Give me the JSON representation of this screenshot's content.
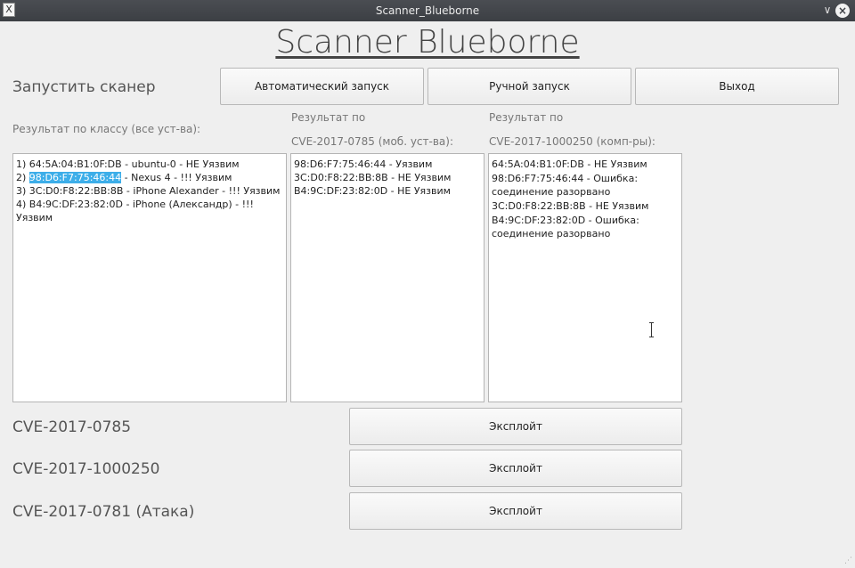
{
  "window": {
    "title": "Scanner_Blueborne",
    "app_icon_glyph": "X",
    "minimize_glyph": "∨",
    "close_glyph": "×"
  },
  "app_title": "Scanner Blueborne",
  "scanner": {
    "label": "Запустить сканер",
    "auto_button": "Автоматический запуск",
    "manual_button": "Ручной запуск",
    "exit_button": "Выход"
  },
  "results": {
    "class_header": "Результат по классу (все уст-ва):",
    "mob_header_1": "Результат по",
    "mob_header_2": "CVE-2017-0785 (моб. уст-ва):",
    "comp_header_1": "Результат по",
    "comp_header_2": "CVE-2017-1000250 (комп-ры):",
    "class_items": [
      {
        "num": "1)",
        "mac": "64:5A:04:B1:0F:DB",
        "rest": " - ubuntu-0 - НЕ Уязвим"
      },
      {
        "num": "2)",
        "mac": "98:D6:F7:75:46:44",
        "rest": " - Nexus 4 - !!!  Уязвим"
      },
      {
        "num": "3)",
        "mac": "3C:D0:F8:22:BB:8B",
        "rest": " - iPhone Alexander - !!!  Уязвим"
      },
      {
        "num": "4)",
        "mac": "B4:9C:DF:23:82:0D",
        "rest": " - iPhone (Александр) - !!!  Уязвим"
      }
    ],
    "mob_items": [
      "98:D6:F7:75:46:44 - Уязвим",
      "3C:D0:F8:22:BB:8B - НЕ Уязвим",
      "B4:9C:DF:23:82:0D - НЕ Уязвим"
    ],
    "comp_items": [
      "64:5A:04:B1:0F:DB - НЕ Уязвим",
      "98:D6:F7:75:46:44 - Ошибка: соединение разорвано",
      "3C:D0:F8:22:BB:8B - НЕ Уязвим",
      "B4:9C:DF:23:82:0D - Ошибка: соединение разорвано"
    ]
  },
  "exploits": [
    {
      "label": "CVE-2017-0785",
      "button": "Эксплойт"
    },
    {
      "label": "CVE-2017-1000250",
      "button": "Эксплойт"
    },
    {
      "label": "CVE-2017-0781 (Атака)",
      "button": "Эксплойт"
    }
  ],
  "colors": {
    "selection": "#3daee9",
    "titlebar": "#3c3f44"
  }
}
